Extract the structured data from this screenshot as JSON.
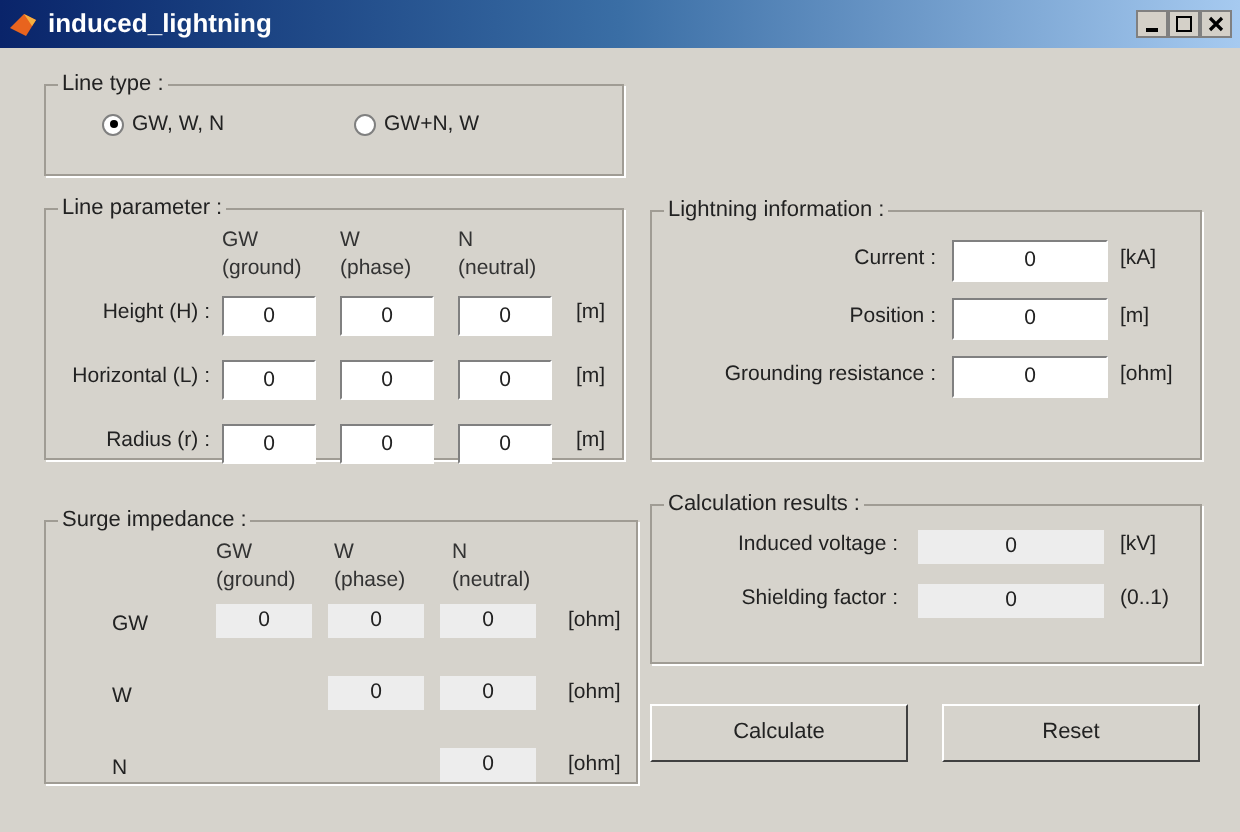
{
  "window": {
    "title": "induced_lightning"
  },
  "line_type": {
    "label": "Line type :",
    "options": [
      {
        "label": "GW, W, N",
        "selected": true
      },
      {
        "label": "GW+N, W",
        "selected": false
      }
    ]
  },
  "line_parameter": {
    "label": "Line parameter :",
    "columns": [
      {
        "name": "GW",
        "sub": "(ground)"
      },
      {
        "name": "W",
        "sub": "(phase)"
      },
      {
        "name": "N",
        "sub": "(neutral)"
      }
    ],
    "rows": [
      {
        "label": "Height (H) :",
        "values": [
          "0",
          "0",
          "0"
        ],
        "unit": "[m]"
      },
      {
        "label": "Horizontal (L) :",
        "values": [
          "0",
          "0",
          "0"
        ],
        "unit": "[m]"
      },
      {
        "label": "Radius (r) :",
        "values": [
          "0",
          "0",
          "0"
        ],
        "unit": "[m]"
      }
    ]
  },
  "surge_impedance": {
    "label": "Surge impedance :",
    "columns": [
      {
        "name": "GW",
        "sub": "(ground)"
      },
      {
        "name": "W",
        "sub": "(phase)"
      },
      {
        "name": "N",
        "sub": "(neutral)"
      }
    ],
    "rows": [
      {
        "label": "GW",
        "values": [
          "0",
          "0",
          "0"
        ],
        "unit": "[ohm]"
      },
      {
        "label": "W",
        "values": [
          "0",
          "0"
        ],
        "unit": "[ohm]"
      },
      {
        "label": "N",
        "values": [
          "0"
        ],
        "unit": "[ohm]"
      }
    ]
  },
  "lightning_information": {
    "label": "Lightning information :",
    "fields": [
      {
        "label": "Current :",
        "value": "0",
        "unit": "[kA]"
      },
      {
        "label": "Position :",
        "value": "0",
        "unit": "[m]"
      },
      {
        "label": "Grounding resistance :",
        "value": "0",
        "unit": "[ohm]"
      }
    ]
  },
  "calculation_results": {
    "label": "Calculation results :",
    "fields": [
      {
        "label": "Induced voltage :",
        "value": "0",
        "unit": "[kV]"
      },
      {
        "label": "Shielding factor :",
        "value": "0",
        "unit": "(0..1)"
      }
    ]
  },
  "buttons": [
    "Calculate",
    "Reset"
  ]
}
